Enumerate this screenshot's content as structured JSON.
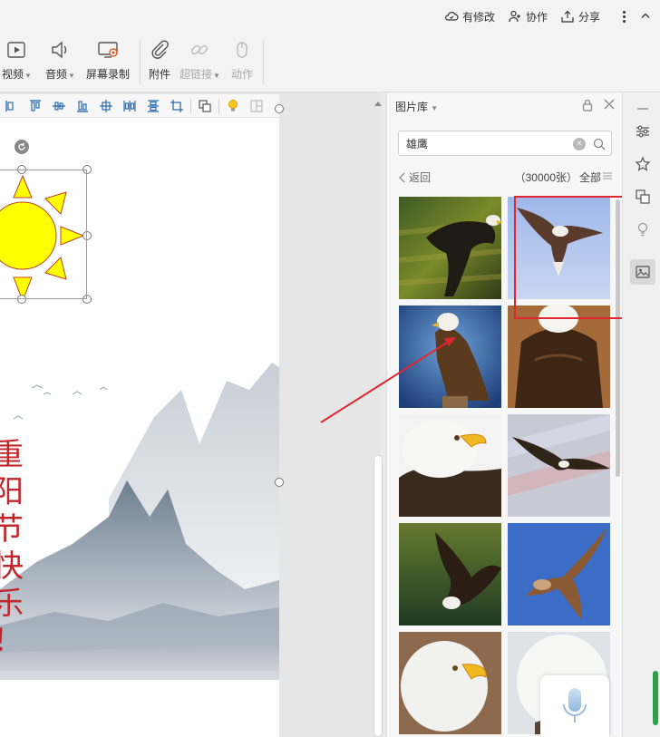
{
  "topbar": {
    "actions": [
      {
        "label": "有修改",
        "icon": "cloud-check-icon"
      },
      {
        "label": "协作",
        "icon": "add-user-icon"
      },
      {
        "label": "分享",
        "icon": "share-icon"
      }
    ]
  },
  "ribbon": {
    "items": [
      {
        "label": "视频",
        "icon": "video-icon",
        "has_menu": true,
        "enabled": true
      },
      {
        "label": "音频",
        "icon": "audio-icon",
        "has_menu": true,
        "enabled": true
      },
      {
        "label": "屏幕录制",
        "icon": "screen-record-icon",
        "has_menu": false,
        "enabled": true
      },
      {
        "label": "附件",
        "icon": "paperclip-icon",
        "has_menu": false,
        "enabled": true
      },
      {
        "label": "超链接",
        "icon": "link-icon",
        "has_menu": true,
        "enabled": false
      },
      {
        "label": "动作",
        "icon": "mouse-icon",
        "has_menu": false,
        "enabled": false
      }
    ]
  },
  "slide": {
    "vertical_text": [
      "重",
      "阳",
      "节",
      "快",
      "乐",
      "！"
    ],
    "text_color": "#c0262c",
    "sun_fill": "#ffff00",
    "sun_stroke": "#c04020"
  },
  "panel": {
    "title": "图片库",
    "search_value": "雄鹰",
    "back_label": "返回",
    "count_label": "（30000张）",
    "all_label": "全部",
    "images": [
      {
        "icon": "eagle-flying-forest-icon"
      },
      {
        "icon": "eagle-flying-sky-icon"
      },
      {
        "icon": "eagle-perched-icon"
      },
      {
        "icon": "eagle-back-icon"
      },
      {
        "icon": "eagle-head-icon"
      },
      {
        "icon": "eagle-flag-icon"
      },
      {
        "icon": "eagle-lake-icon"
      },
      {
        "icon": "hawk-blue-sky-icon"
      },
      {
        "icon": "eagle-portrait-icon"
      },
      {
        "icon": "eagle-white-icon"
      }
    ]
  },
  "colors": {
    "accent_red": "#e0262e",
    "panel_bg": "#f7f7f7"
  }
}
